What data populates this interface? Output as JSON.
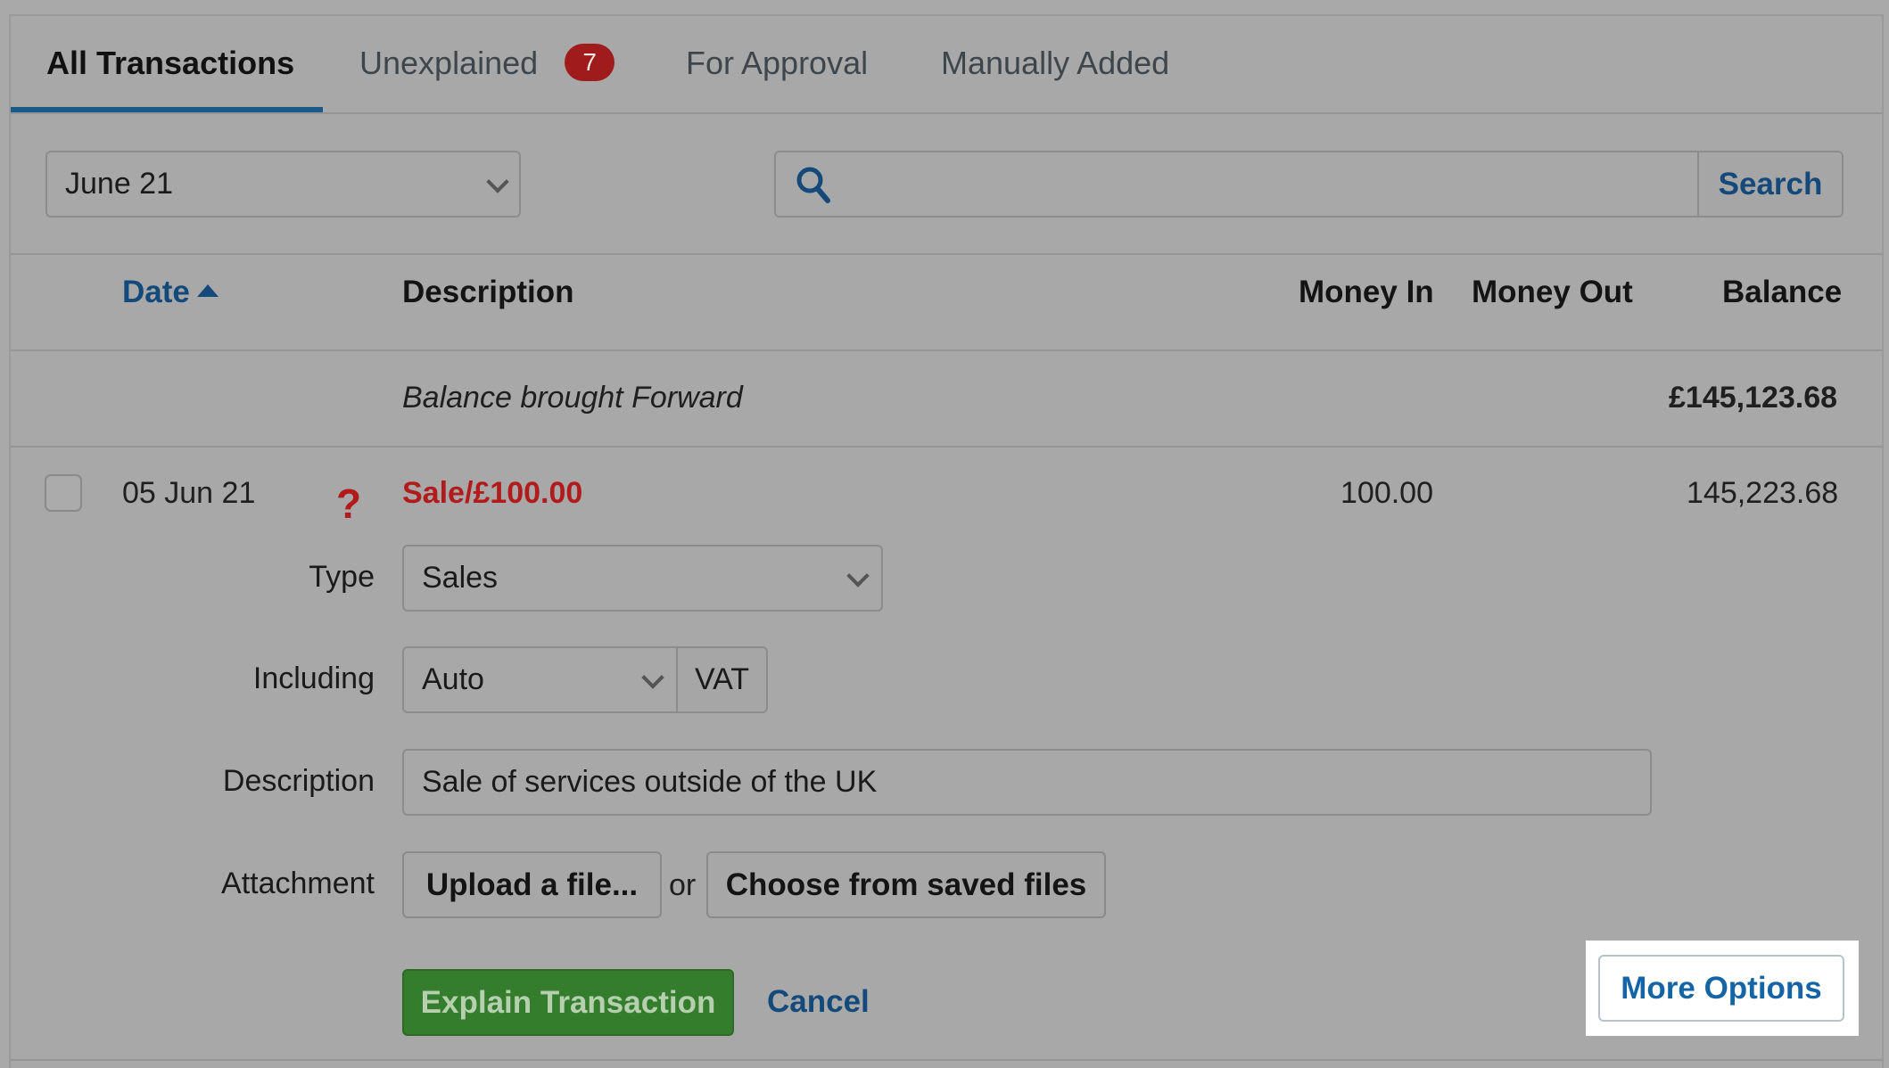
{
  "tabs": [
    {
      "label": "All Transactions",
      "active": true
    },
    {
      "label": "Unexplained",
      "badge": "7"
    },
    {
      "label": "For Approval"
    },
    {
      "label": "Manually Added"
    }
  ],
  "filter": {
    "period_value": "June 21",
    "search_placeholder": "",
    "search_button": "Search"
  },
  "columns": {
    "date": "Date",
    "description": "Description",
    "money_in": "Money In",
    "money_out": "Money Out",
    "balance": "Balance"
  },
  "brought_forward": {
    "label": "Balance brought Forward",
    "balance": "£145,123.68"
  },
  "transaction": {
    "date": "05 Jun 21",
    "status_icon": "question-mark",
    "description": "Sale/£100.00",
    "money_in": "100.00",
    "balance": "145,223.68"
  },
  "form": {
    "type_label": "Type",
    "type_value": "Sales",
    "including_label": "Including",
    "including_value": "Auto",
    "vat_label": "VAT",
    "description_label": "Description",
    "description_value": "Sale of services outside of the UK",
    "attachment_label": "Attachment",
    "upload_button": "Upload a file...",
    "or_text": "or",
    "saved_files_button": "Choose from saved files",
    "explain_button": "Explain Transaction",
    "cancel_link": "Cancel",
    "more_options_button": "More Options"
  },
  "colors": {
    "accent": "#134a7b",
    "danger": "#b21b1b",
    "success": "#347d2c"
  }
}
